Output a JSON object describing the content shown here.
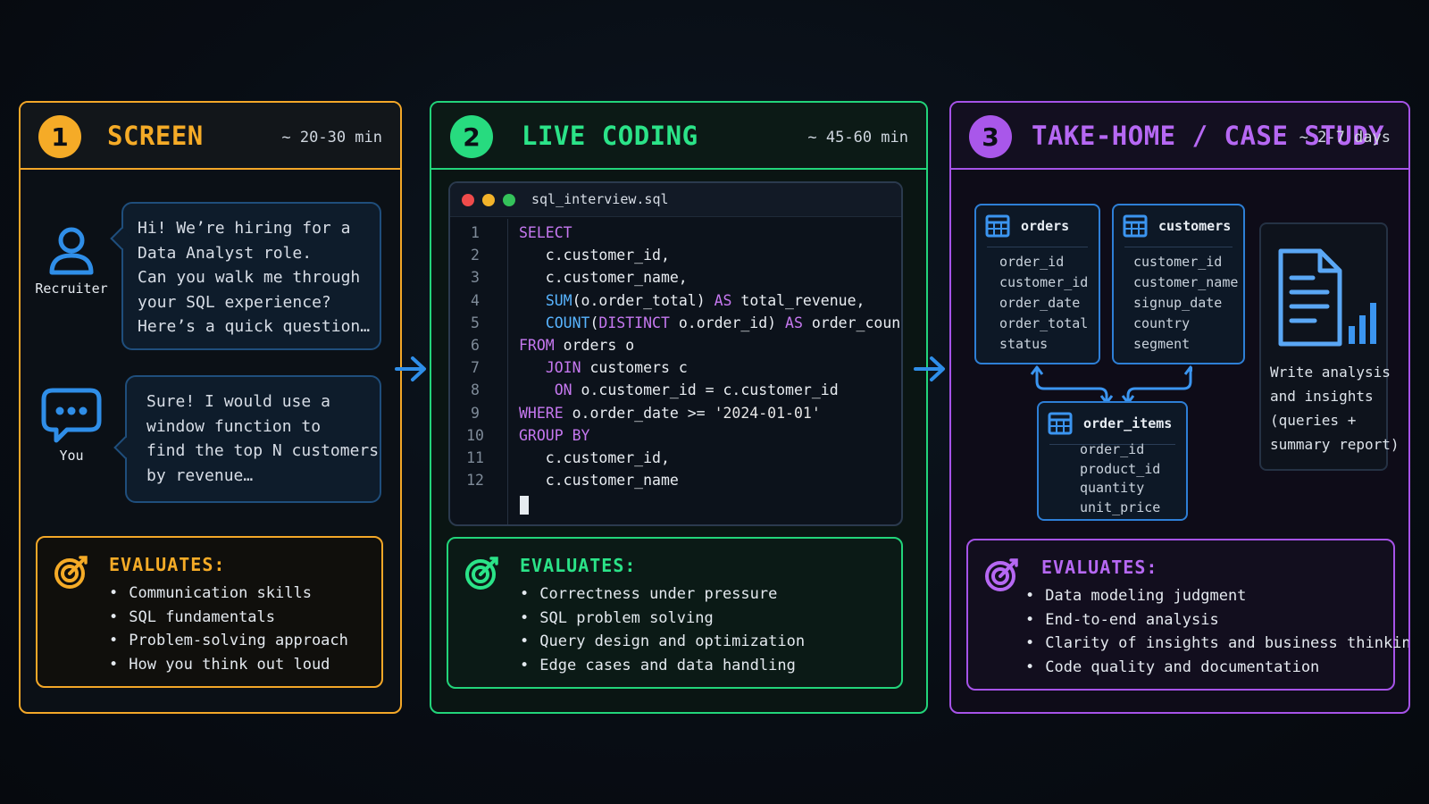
{
  "colors": {
    "screen": "#f5ab27",
    "live_coding": "#2be388",
    "take_home": "#b668f3",
    "arrow": "#2f8ee8",
    "chat_border": "#1f4e7c"
  },
  "panels": [
    {
      "number": "1",
      "title": "SCREEN",
      "duration": "~ 20-30 min",
      "recruiter": {
        "icon": "person-icon",
        "label": "Recruiter",
        "message_lines": [
          "Hi! We’re hiring for a",
          "Data Analyst role.",
          "Can you walk me through",
          "your SQL experience?",
          "Here’s a quick question…"
        ]
      },
      "you": {
        "icon": "chat-bubble-icon",
        "label": "You",
        "message_lines": [
          "Sure! I would use a",
          "window function to",
          "find the top N customers",
          "by revenue…"
        ]
      },
      "evaluates": {
        "icon": "target-icon",
        "title": "EVALUATES:",
        "items": [
          "Communication skills",
          "SQL fundamentals",
          "Problem-solving approach",
          "How you think out loud"
        ]
      }
    },
    {
      "number": "2",
      "title": "LIVE CODING",
      "duration": "~ 45-60 min",
      "editor": {
        "filename": "sql_interview.sql",
        "line_numbers": [
          "1",
          "2",
          "3",
          "4",
          "5",
          "6",
          "7",
          "8",
          "9",
          "10",
          "11",
          "12"
        ]
      },
      "evaluates": {
        "icon": "target-icon",
        "title": "EVALUATES:",
        "items": [
          "Correctness under pressure",
          "SQL problem solving",
          "Query design and optimization",
          "Edge cases and data handling"
        ]
      }
    },
    {
      "number": "3",
      "title": "TAKE-HOME / CASE STUDY",
      "duration": "~ 2-7 days",
      "tables": [
        {
          "name": "orders",
          "icon": "table-icon",
          "fields": [
            "order_id",
            "customer_id",
            "order_date",
            "order_total",
            "status"
          ]
        },
        {
          "name": "customers",
          "icon": "table-icon",
          "fields": [
            "customer_id",
            "customer_name",
            "signup_date",
            "country",
            "segment"
          ]
        },
        {
          "name": "order_items",
          "icon": "table-icon",
          "fields": [
            "order_id",
            "product_id",
            "quantity",
            "unit_price"
          ]
        }
      ],
      "report": {
        "icon": "document-chart-icon",
        "lines": [
          "Write analysis",
          "and insights",
          "(queries +",
          "summary report)"
        ]
      },
      "evaluates": {
        "icon": "target-icon",
        "title": "EVALUATES:",
        "items": [
          "Data modeling judgment",
          "End-to-end analysis",
          "Clarity of insights and business thinking",
          "Code quality and documentation"
        ]
      }
    }
  ],
  "code_lines": [
    [
      {
        "t": "SELECT",
        "c": "kw"
      }
    ],
    [
      {
        "t": "   c.customer_id,",
        "c": ""
      }
    ],
    [
      {
        "t": "   c.customer_name,",
        "c": ""
      }
    ],
    [
      {
        "t": "   ",
        "c": ""
      },
      {
        "t": "SUM",
        "c": "fn"
      },
      {
        "t": "(o.order_total) ",
        "c": ""
      },
      {
        "t": "AS",
        "c": "kw"
      },
      {
        "t": " total_revenue,",
        "c": ""
      }
    ],
    [
      {
        "t": "   ",
        "c": ""
      },
      {
        "t": "COUNT",
        "c": "fn"
      },
      {
        "t": "(",
        "c": ""
      },
      {
        "t": "DISTINCT",
        "c": "kw"
      },
      {
        "t": " o.order_id) ",
        "c": ""
      },
      {
        "t": "AS",
        "c": "kw"
      },
      {
        "t": " order_count",
        "c": ""
      }
    ],
    [
      {
        "t": "FROM",
        "c": "kw"
      },
      {
        "t": " orders o",
        "c": ""
      }
    ],
    [
      {
        "t": "   ",
        "c": ""
      },
      {
        "t": "JOIN",
        "c": "kw"
      },
      {
        "t": " customers c",
        "c": ""
      }
    ],
    [
      {
        "t": "    ",
        "c": ""
      },
      {
        "t": "ON",
        "c": "kw"
      },
      {
        "t": " o.customer_id = c.customer_id",
        "c": ""
      }
    ],
    [
      {
        "t": "WHERE",
        "c": "kw"
      },
      {
        "t": " o.order_date >= ",
        "c": ""
      },
      {
        "t": "'2024-01-01'",
        "c": "str"
      }
    ],
    [
      {
        "t": "GROUP BY",
        "c": "kw"
      }
    ],
    [
      {
        "t": "   c.customer_id,",
        "c": ""
      }
    ],
    [
      {
        "t": "   c.customer_name",
        "c": ""
      }
    ]
  ]
}
